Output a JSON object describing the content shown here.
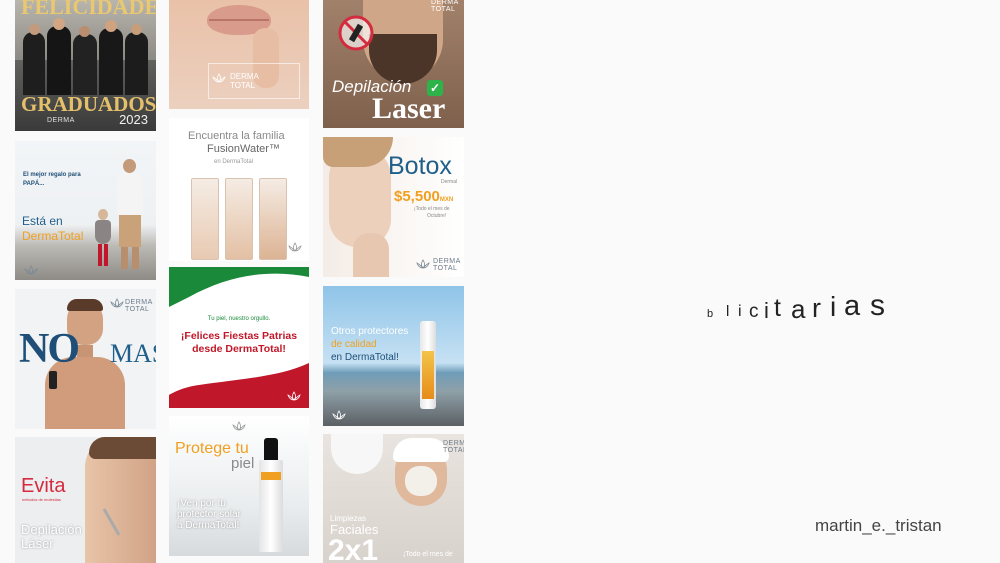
{
  "headline": {
    "letters": [
      "b",
      "l",
      "i",
      "c",
      "i",
      "t",
      "a",
      "r",
      "i",
      "a",
      "s"
    ]
  },
  "handle": "martin_e._tristan",
  "brand": {
    "line1": "DERMA",
    "line2": "TOTAL"
  },
  "graduados": {
    "top": "FELICIDADES",
    "main": "GRADUADOS",
    "year": "2023"
  },
  "papa": {
    "line1": "El mejor regalo para",
    "line2": "PAPÁ...",
    "line3": "Está en",
    "line4": "DermaTotal"
  },
  "nomas": {
    "no": "NO",
    "mas": "MAS"
  },
  "evita": {
    "title": "Evita",
    "sub": "métodos de molestias",
    "line1": "Depilación",
    "line2": "Láser"
  },
  "fusion": {
    "line1": "Encuentra la familia",
    "line2": "FusionWater™",
    "line3": "en DermaTotal"
  },
  "patrias": {
    "line1": "Tu piel, nuestro orgullo.",
    "line2": "¡Felices Fiestas Patrias",
    "line3": "desde DermaTotal!"
  },
  "protege": {
    "line1": "Protege tu",
    "line2": "piel",
    "body1": "¡Ven por tu",
    "body2": "protector solar",
    "body3": "a DermaTotal!"
  },
  "depilacion": {
    "line1": "Depilación",
    "line2": "Laser",
    "check": "✓"
  },
  "botox": {
    "title": "Botox",
    "sub": "Dermal",
    "price": "$5,500",
    "currency": "MXN",
    "note1": "¡Todo el mes de",
    "note2": "Octubre!"
  },
  "protector": {
    "line1": "Otros protectores",
    "line2": "de calidad",
    "line3": "en DermaTotal!"
  },
  "limpiezas": {
    "line1": "Limpiezas",
    "line2": "Faciales",
    "big": "2x1",
    "note": "¡Todo el mes de"
  },
  "colors": {
    "accent_orange": "#f0a020",
    "brand_blue": "#1f5f8a",
    "patria_red": "#c0182a",
    "patria_green": "#1a8a3a"
  }
}
